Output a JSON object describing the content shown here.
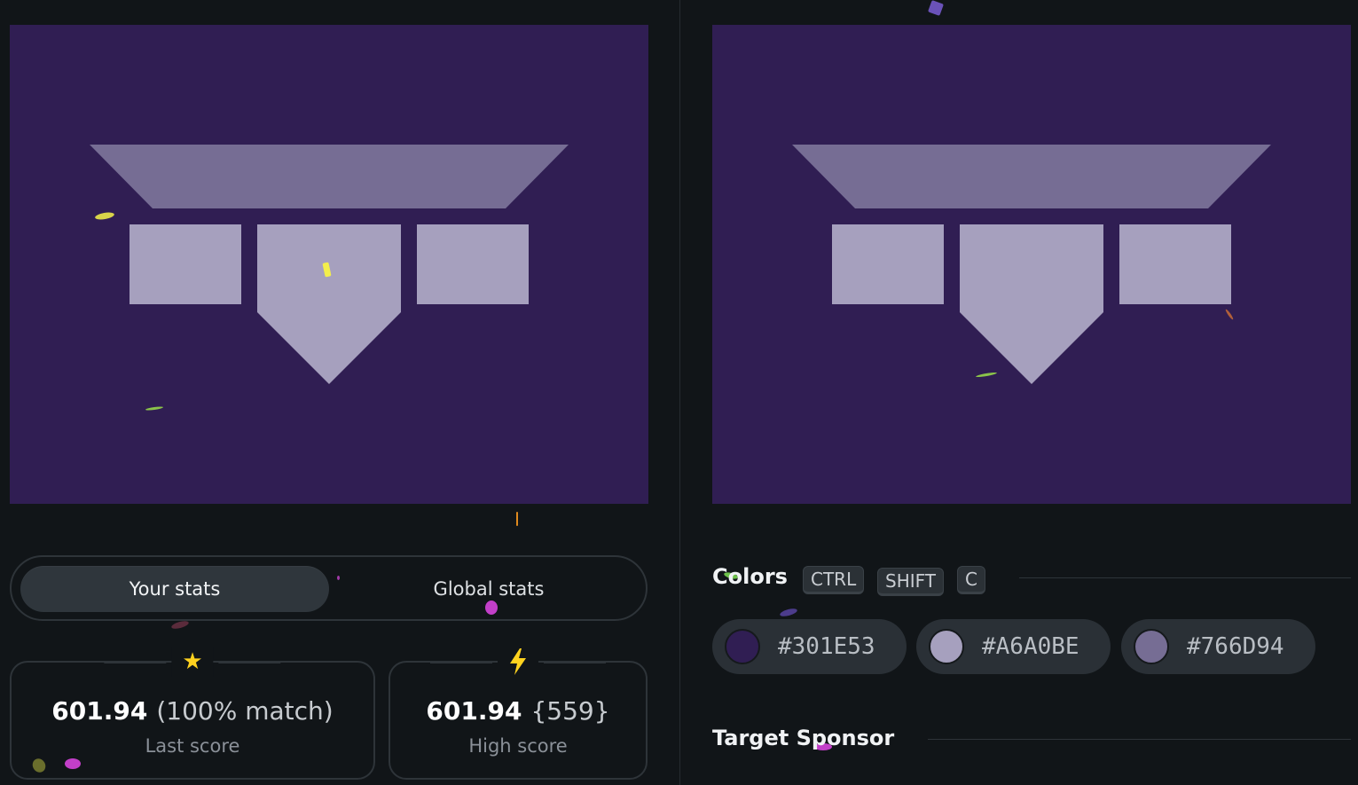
{
  "stats_toggle": {
    "your_stats": "Your stats",
    "global_stats": "Global stats",
    "selected": "Your stats"
  },
  "last_score": {
    "icon": "star-icon",
    "value": "601.94",
    "extra": "(100% match)",
    "label": "Last score"
  },
  "high_score": {
    "icon": "lightning-icon",
    "value": "601.94",
    "extra": "{559}",
    "label": "High score"
  },
  "colors_section": {
    "heading": "Colors",
    "shortcut_keys": [
      "CTRL",
      "SHIFT",
      "C"
    ],
    "swatches": [
      {
        "hex": "#301E53",
        "color": "#301e53"
      },
      {
        "hex": "#A6A0BE",
        "color": "#a6a0be"
      },
      {
        "hex": "#766D94",
        "color": "#766d94"
      }
    ]
  },
  "sponsor_section": {
    "heading": "Target Sponsor"
  },
  "theme": {
    "background": "#111518",
    "canvas_bg": "#301e53",
    "shape_light": "#a6a0be",
    "shape_mid": "#766d94",
    "accent_star": "#ffd21f"
  }
}
